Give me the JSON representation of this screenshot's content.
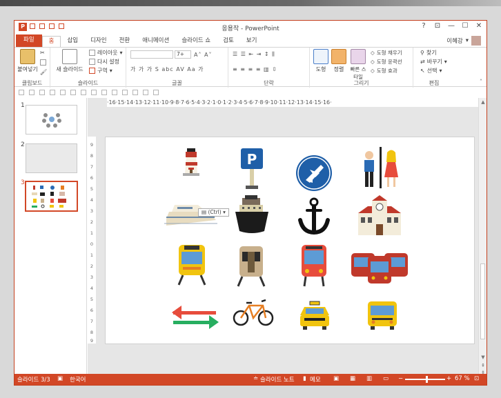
{
  "window": {
    "title": "응용작 - PowerPoint",
    "app_icon_letter": "P"
  },
  "window_controls": [
    "?",
    "⊡",
    "—",
    "☐",
    "✕"
  ],
  "tabs": [
    {
      "label": "파일",
      "kind": "file"
    },
    {
      "label": "홈",
      "kind": "active"
    },
    {
      "label": "삽입"
    },
    {
      "label": "디자인"
    },
    {
      "label": "전환"
    },
    {
      "label": "애니메이션"
    },
    {
      "label": "슬라이드 쇼"
    },
    {
      "label": "검토"
    },
    {
      "label": "보기"
    }
  ],
  "user": {
    "name": "이혜강"
  },
  "ribbon": {
    "clipboard": {
      "paste_label": "붙여넣기",
      "group_label": "클립보드"
    },
    "slides": {
      "new_slide_label": "새 슬라이드",
      "layout_label": "레이아웃",
      "reset_label": "다시 설정",
      "section_label": "구역",
      "group_label": "슬라이드"
    },
    "font": {
      "group_label": "글꼴",
      "size": "7+",
      "row2": "가 가 가 S abc AV Aa 가"
    },
    "paragraph": {
      "group_label": "단락"
    },
    "drawing": {
      "shape_label": "도형",
      "arrange_label": "정렬",
      "quick_style_label": "빠른 스타일",
      "fill_label": "도형 채우기",
      "outline_label": "도형 윤곽선",
      "effect_label": "도형 효과",
      "group_label": "그리기"
    },
    "editing": {
      "find_label": "찾기",
      "replace_label": "바꾸기",
      "select_label": "선택",
      "group_label": "편집"
    }
  },
  "ruler": {
    "horizontal": "·16·15·14·13·12·11·10·9·8·7·6·5·4·3·2·1·0·1·2·3·4·5·6·7·8·9·10·11·12·13·14·15·16·"
  },
  "slides_panel": [
    {
      "number": "1",
      "state": "normal"
    },
    {
      "number": "2",
      "state": "blank"
    },
    {
      "number": "3",
      "state": "selected"
    }
  ],
  "paste_options": {
    "label": "(Ctrl)"
  },
  "icons_on_slide": [
    "lighthouse-icon",
    "parking-sign-icon",
    "airport-sign-icon",
    "restroom-sign-icon",
    "ferry-icon",
    "ship-icon",
    "anchor-icon",
    "station-building-icon",
    "tram-icon",
    "subway-icon",
    "bus-front-icon",
    "double-decker-buses-icon",
    "transfer-arrows-icon",
    "bicycle-icon",
    "taxi-icon",
    "school-bus-icon"
  ],
  "status": {
    "slide_info": "슬라이드 3/3",
    "language": "한국어",
    "notes_label": "슬라이드 노트",
    "comments_label": "메모",
    "zoom": "67 %"
  },
  "colors": {
    "accent": "#D24726",
    "status_bar": "#D24726"
  }
}
